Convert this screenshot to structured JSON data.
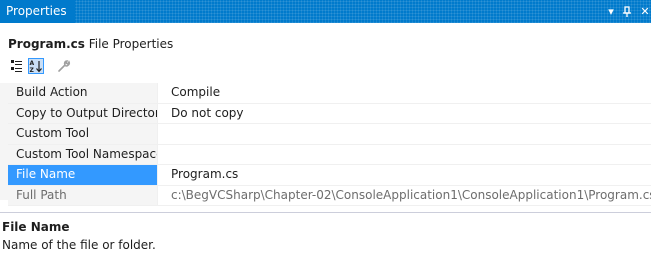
{
  "window": {
    "title": "Properties",
    "dropdown_glyph": "▾",
    "pin_glyph": "⊥",
    "close_glyph": "✕",
    "accent": "#007acc"
  },
  "object": {
    "name": "Program.cs",
    "type": "File Properties"
  },
  "toolbar": {
    "buttons": [
      {
        "icon": "categorized-icon"
      },
      {
        "icon": "alphabetical-sort-icon",
        "active": true
      },
      {
        "icon": "property-pages-wrench-icon"
      }
    ]
  },
  "properties": [
    {
      "name": "Build Action",
      "value": "Compile"
    },
    {
      "name": "Copy to Output Directory",
      "value": "Do not copy"
    },
    {
      "name": "Custom Tool",
      "value": ""
    },
    {
      "name": "Custom Tool Namespace",
      "value": ""
    },
    {
      "name": "File Name",
      "value": "Program.cs",
      "selected": true
    },
    {
      "name": "Full Path",
      "value": "c:\\BegVCSharp\\Chapter-02\\ConsoleApplication1\\ConsoleApplication1\\Program.cs",
      "readonly": true
    }
  ],
  "description": {
    "title": "File Name",
    "text": "Name of the file or folder."
  },
  "colors": {
    "selection": "#3399ff",
    "readonly_text": "#6d6d6d"
  }
}
